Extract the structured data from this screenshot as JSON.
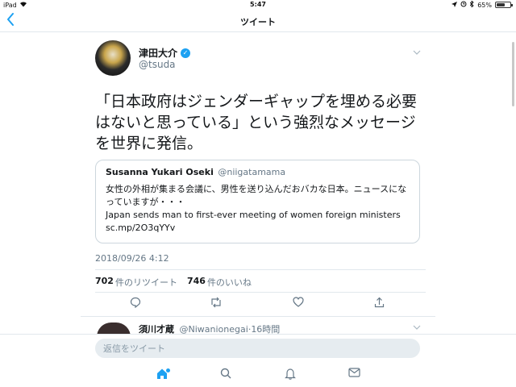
{
  "statusbar": {
    "device": "iPad",
    "time": "5:47",
    "battery_text": "65%",
    "battery_level": 0.65
  },
  "nav": {
    "back_icon": "chevron-left-icon",
    "title": "ツイート"
  },
  "tweet": {
    "name": "津田大介",
    "handle": "@tsuda",
    "text": "「日本政府はジェンダーギャップを埋める必要はないと思っている」という強烈なメッセージを世界に発信。",
    "date": "2018/09/26 4:12",
    "retweets": "702",
    "retweets_label": "件のリツイート",
    "likes": "746",
    "likes_label": "件のいいね"
  },
  "quote": {
    "name": "Susanna Yukari Oseki",
    "handle": "@niigatamama",
    "line1": "女性の外相が集まる会議に、男性を送り込んだおバカな日本。ニュースになっていますが・・・",
    "line2": "Japan sends man to first-ever meeting of women foreign ministers",
    "line3": "sc.mp/2O3qYYv"
  },
  "reply_preview": {
    "name": "須川才蔵",
    "handle": "@Niwanionegai",
    "time": "16時間"
  },
  "reply_bar": {
    "placeholder": "返信をツイート"
  },
  "actions": [
    "reply-icon",
    "retweet-icon",
    "like-icon",
    "share-icon"
  ],
  "tabs": [
    "home-icon",
    "search-icon",
    "notifications-icon",
    "messages-icon"
  ],
  "colors": {
    "accent": "#1da1f2",
    "secondary_text": "#657786"
  }
}
